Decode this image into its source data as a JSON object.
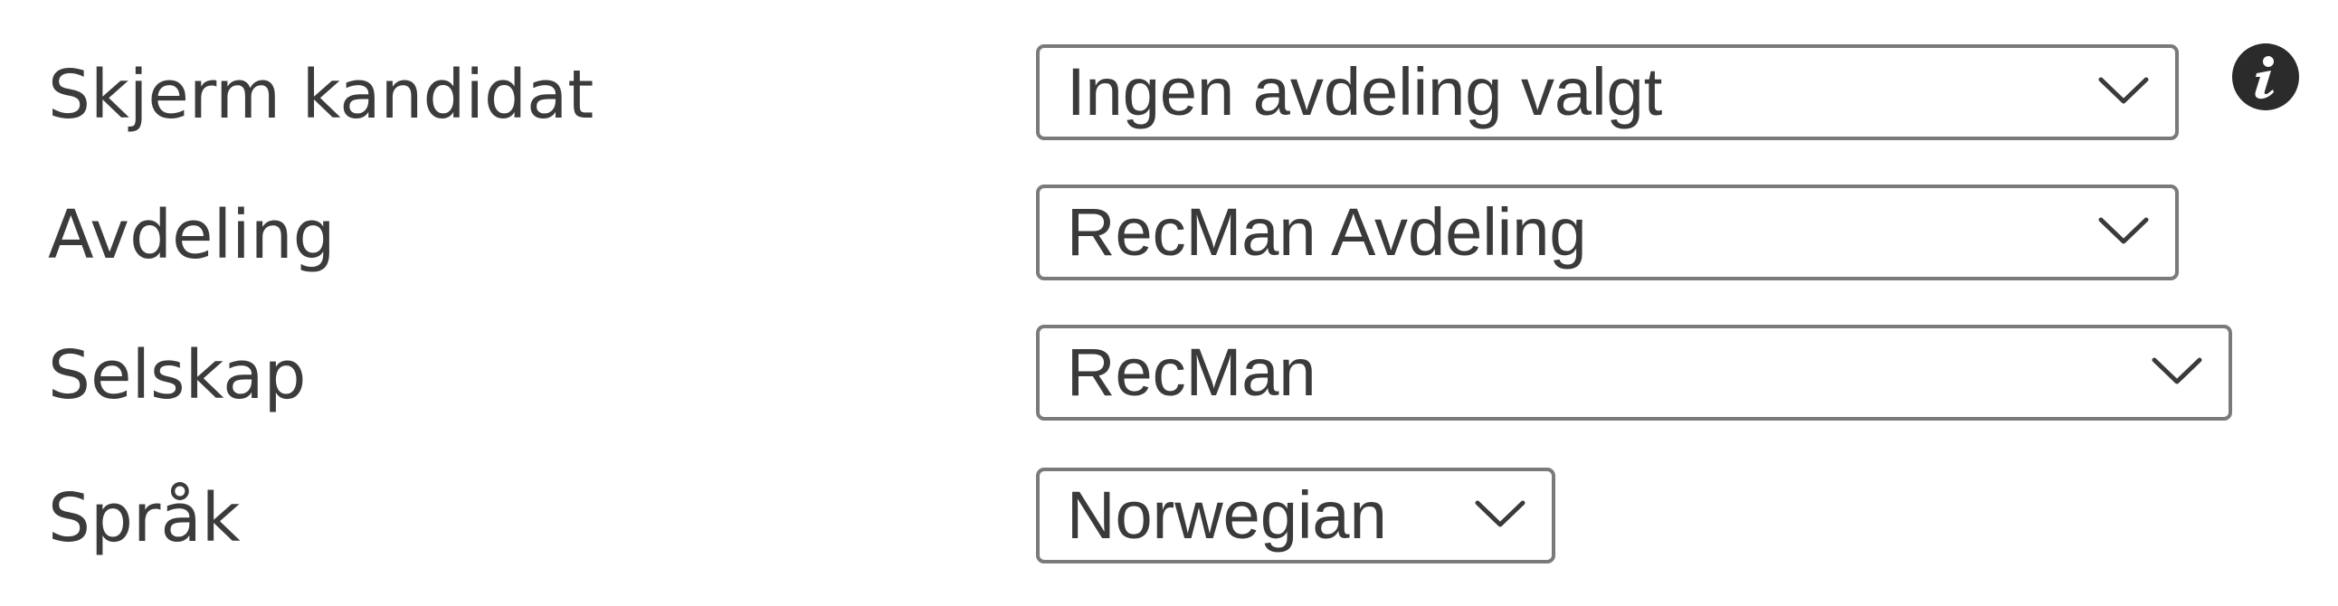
{
  "form": {
    "rows": [
      {
        "label": "Skjerm kandidat",
        "value": "Ingen avdeling valgt"
      },
      {
        "label": "Avdeling",
        "value": "RecMan Avdeling"
      },
      {
        "label": "Selskap",
        "value": "RecMan"
      },
      {
        "label": "Språk",
        "value": "Norwegian"
      }
    ],
    "info_icon": "info-icon",
    "chevron_icon": "chevron-down-icon"
  },
  "colors": {
    "label_text": "#3b3b3b",
    "field_text": "#3a3a3a",
    "field_border": "#7a7a7a",
    "info_background": "#2b2b2b",
    "background": "#ffffff"
  }
}
